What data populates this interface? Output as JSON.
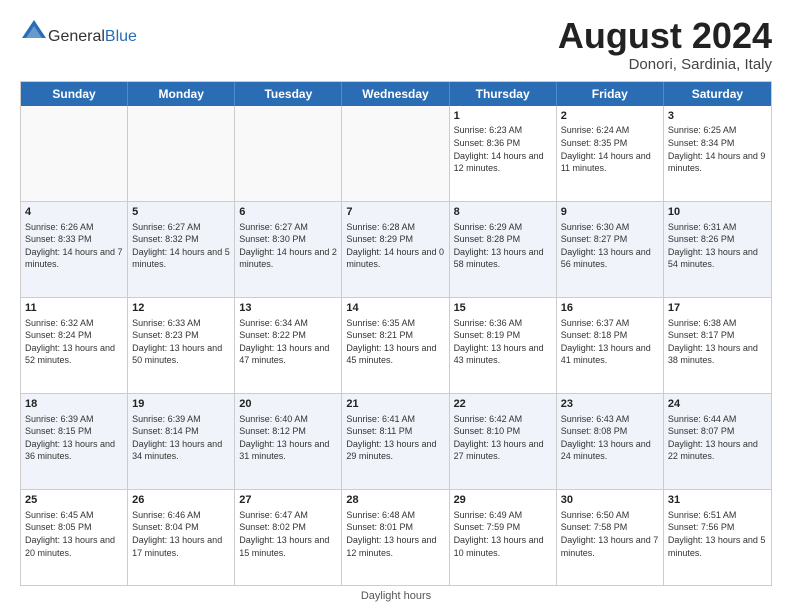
{
  "header": {
    "logo_general": "General",
    "logo_blue": "Blue",
    "month_year": "August 2024",
    "location": "Donori, Sardinia, Italy"
  },
  "days_of_week": [
    "Sunday",
    "Monday",
    "Tuesday",
    "Wednesday",
    "Thursday",
    "Friday",
    "Saturday"
  ],
  "footer": {
    "note": "Daylight hours"
  },
  "weeks": [
    [
      {
        "day": "",
        "info": ""
      },
      {
        "day": "",
        "info": ""
      },
      {
        "day": "",
        "info": ""
      },
      {
        "day": "",
        "info": ""
      },
      {
        "day": "1",
        "info": "Sunrise: 6:23 AM\nSunset: 8:36 PM\nDaylight: 14 hours\nand 12 minutes."
      },
      {
        "day": "2",
        "info": "Sunrise: 6:24 AM\nSunset: 8:35 PM\nDaylight: 14 hours\nand 11 minutes."
      },
      {
        "day": "3",
        "info": "Sunrise: 6:25 AM\nSunset: 8:34 PM\nDaylight: 14 hours\nand 9 minutes."
      }
    ],
    [
      {
        "day": "4",
        "info": "Sunrise: 6:26 AM\nSunset: 8:33 PM\nDaylight: 14 hours\nand 7 minutes."
      },
      {
        "day": "5",
        "info": "Sunrise: 6:27 AM\nSunset: 8:32 PM\nDaylight: 14 hours\nand 5 minutes."
      },
      {
        "day": "6",
        "info": "Sunrise: 6:27 AM\nSunset: 8:30 PM\nDaylight: 14 hours\nand 2 minutes."
      },
      {
        "day": "7",
        "info": "Sunrise: 6:28 AM\nSunset: 8:29 PM\nDaylight: 14 hours\nand 0 minutes."
      },
      {
        "day": "8",
        "info": "Sunrise: 6:29 AM\nSunset: 8:28 PM\nDaylight: 13 hours\nand 58 minutes."
      },
      {
        "day": "9",
        "info": "Sunrise: 6:30 AM\nSunset: 8:27 PM\nDaylight: 13 hours\nand 56 minutes."
      },
      {
        "day": "10",
        "info": "Sunrise: 6:31 AM\nSunset: 8:26 PM\nDaylight: 13 hours\nand 54 minutes."
      }
    ],
    [
      {
        "day": "11",
        "info": "Sunrise: 6:32 AM\nSunset: 8:24 PM\nDaylight: 13 hours\nand 52 minutes."
      },
      {
        "day": "12",
        "info": "Sunrise: 6:33 AM\nSunset: 8:23 PM\nDaylight: 13 hours\nand 50 minutes."
      },
      {
        "day": "13",
        "info": "Sunrise: 6:34 AM\nSunset: 8:22 PM\nDaylight: 13 hours\nand 47 minutes."
      },
      {
        "day": "14",
        "info": "Sunrise: 6:35 AM\nSunset: 8:21 PM\nDaylight: 13 hours\nand 45 minutes."
      },
      {
        "day": "15",
        "info": "Sunrise: 6:36 AM\nSunset: 8:19 PM\nDaylight: 13 hours\nand 43 minutes."
      },
      {
        "day": "16",
        "info": "Sunrise: 6:37 AM\nSunset: 8:18 PM\nDaylight: 13 hours\nand 41 minutes."
      },
      {
        "day": "17",
        "info": "Sunrise: 6:38 AM\nSunset: 8:17 PM\nDaylight: 13 hours\nand 38 minutes."
      }
    ],
    [
      {
        "day": "18",
        "info": "Sunrise: 6:39 AM\nSunset: 8:15 PM\nDaylight: 13 hours\nand 36 minutes."
      },
      {
        "day": "19",
        "info": "Sunrise: 6:39 AM\nSunset: 8:14 PM\nDaylight: 13 hours\nand 34 minutes."
      },
      {
        "day": "20",
        "info": "Sunrise: 6:40 AM\nSunset: 8:12 PM\nDaylight: 13 hours\nand 31 minutes."
      },
      {
        "day": "21",
        "info": "Sunrise: 6:41 AM\nSunset: 8:11 PM\nDaylight: 13 hours\nand 29 minutes."
      },
      {
        "day": "22",
        "info": "Sunrise: 6:42 AM\nSunset: 8:10 PM\nDaylight: 13 hours\nand 27 minutes."
      },
      {
        "day": "23",
        "info": "Sunrise: 6:43 AM\nSunset: 8:08 PM\nDaylight: 13 hours\nand 24 minutes."
      },
      {
        "day": "24",
        "info": "Sunrise: 6:44 AM\nSunset: 8:07 PM\nDaylight: 13 hours\nand 22 minutes."
      }
    ],
    [
      {
        "day": "25",
        "info": "Sunrise: 6:45 AM\nSunset: 8:05 PM\nDaylight: 13 hours\nand 20 minutes."
      },
      {
        "day": "26",
        "info": "Sunrise: 6:46 AM\nSunset: 8:04 PM\nDaylight: 13 hours\nand 17 minutes."
      },
      {
        "day": "27",
        "info": "Sunrise: 6:47 AM\nSunset: 8:02 PM\nDaylight: 13 hours\nand 15 minutes."
      },
      {
        "day": "28",
        "info": "Sunrise: 6:48 AM\nSunset: 8:01 PM\nDaylight: 13 hours\nand 12 minutes."
      },
      {
        "day": "29",
        "info": "Sunrise: 6:49 AM\nSunset: 7:59 PM\nDaylight: 13 hours\nand 10 minutes."
      },
      {
        "day": "30",
        "info": "Sunrise: 6:50 AM\nSunset: 7:58 PM\nDaylight: 13 hours\nand 7 minutes."
      },
      {
        "day": "31",
        "info": "Sunrise: 6:51 AM\nSunset: 7:56 PM\nDaylight: 13 hours\nand 5 minutes."
      }
    ]
  ]
}
